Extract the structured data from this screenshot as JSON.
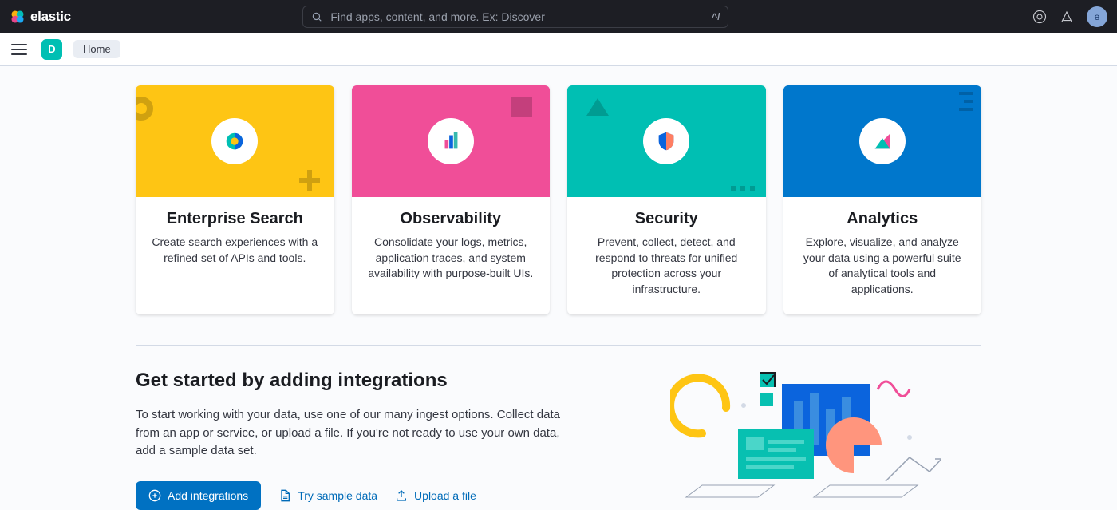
{
  "header": {
    "brand": "elastic",
    "search_placeholder": "Find apps, content, and more. Ex: Discover",
    "search_shortcut": "^/",
    "avatar_initial": "e"
  },
  "subnav": {
    "space_initial": "D",
    "breadcrumb": "Home"
  },
  "cards": [
    {
      "title": "Enterprise Search",
      "desc": "Create search experiences with a refined set of APIs and tools."
    },
    {
      "title": "Observability",
      "desc": "Consolidate your logs, metrics, application traces, and system availability with purpose-built UIs."
    },
    {
      "title": "Security",
      "desc": "Prevent, collect, detect, and respond to threats for unified protection across your infrastructure."
    },
    {
      "title": "Analytics",
      "desc": "Explore, visualize, and analyze your data using a powerful suite of analytical tools and applications."
    }
  ],
  "get_started": {
    "title": "Get started by adding integrations",
    "desc": "To start working with your data, use one of our many ingest options. Collect data from an app or service, or upload a file. If you're not ready to use your own data, add a sample data set.",
    "add_btn": "Add integrations",
    "sample_btn": "Try sample data",
    "upload_btn": "Upload a file"
  }
}
